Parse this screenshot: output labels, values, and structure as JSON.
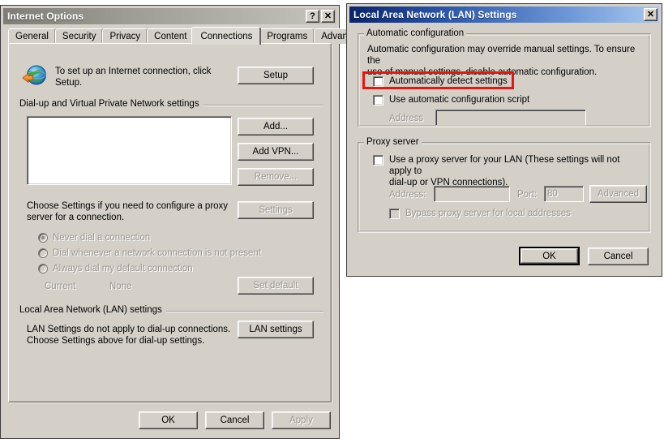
{
  "internet_options": {
    "title": "Internet Options",
    "titlebar_buttons": [
      {
        "name": "help-button",
        "glyph": "?"
      },
      {
        "name": "close-button",
        "glyph": "✕"
      }
    ],
    "tabs": [
      {
        "label": "General",
        "selected": false
      },
      {
        "label": "Security",
        "selected": false
      },
      {
        "label": "Privacy",
        "selected": false
      },
      {
        "label": "Content",
        "selected": false
      },
      {
        "label": "Connections",
        "selected": true
      },
      {
        "label": "Programs",
        "selected": false
      },
      {
        "label": "Advanced",
        "selected": false
      }
    ],
    "setup_text": "To set up an Internet connection, click\nSetup.",
    "setup_button": "Setup",
    "dialup_group_label": "Dial-up and Virtual Private Network settings",
    "dialup_list_items": [],
    "dialup_buttons": [
      {
        "label": "Add...",
        "disabled": false
      },
      {
        "label": "Add VPN...",
        "disabled": false
      },
      {
        "label": "Remove...",
        "disabled": true
      },
      {
        "label": "Settings",
        "disabled": true
      }
    ],
    "choose_settings_text": "Choose Settings if you need to configure a proxy\nserver for a connection.",
    "dial_options": [
      {
        "label": "Never dial a connection",
        "checked": true
      },
      {
        "label": "Dial whenever a network connection is not present",
        "checked": false
      },
      {
        "label": "Always dial my default connection",
        "checked": false
      }
    ],
    "current_label": "Current",
    "current_value": "None",
    "set_default_button": "Set default",
    "lan_group_label": "Local Area Network (LAN) settings",
    "lan_text": "LAN Settings do not apply to dial-up connections.\nChoose Settings above for dial-up settings.",
    "lan_settings_button": "LAN settings",
    "footer_buttons": [
      {
        "label": "OK",
        "disabled": false
      },
      {
        "label": "Cancel",
        "disabled": false
      },
      {
        "label": "Apply",
        "disabled": true
      }
    ]
  },
  "lan_settings": {
    "title": "Local Area Network (LAN) Settings",
    "close_glyph": "✕",
    "auto_config": {
      "group_label": "Automatic configuration",
      "description": "Automatic configuration may override manual settings.  To ensure the\nuse of manual settings, disable automatic configuration.",
      "detect_checkbox": {
        "label": "Automatically detect settings",
        "checked": false,
        "highlighted": true
      },
      "script_checkbox": {
        "label": "Use automatic configuration script",
        "checked": false
      },
      "address_label": "Address",
      "address_value": "",
      "address_disabled": true
    },
    "proxy": {
      "group_label": "Proxy server",
      "use_proxy_checkbox": {
        "label": "Use a proxy server for your LAN (These settings will not apply to\ndial-up or VPN connections).",
        "checked": false
      },
      "address_label": "Address:",
      "address_value": "",
      "port_label": "Port:",
      "port_value": "80",
      "advanced_button": "Advanced",
      "bypass_checkbox": {
        "label": "Bypass proxy server for local addresses",
        "checked": false
      }
    },
    "footer_buttons": [
      {
        "label": "OK",
        "default": true
      },
      {
        "label": "Cancel",
        "default": false
      }
    ]
  },
  "colors": {
    "dialog_face": "#d4d0c8",
    "page_background": "#ffffff",
    "annotation_red": "#e8160f",
    "active_title_start": "#0a246a",
    "inactive_title_start": "#7e7e76"
  }
}
